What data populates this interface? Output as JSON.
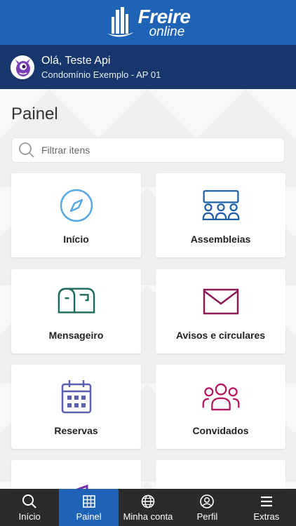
{
  "header": {
    "brand_line1": "Freire",
    "brand_line2": "online"
  },
  "user": {
    "greeting": "Olá, Teste Api",
    "unit": "Condomínio Exemplo - AP 01"
  },
  "page": {
    "title": "Painel"
  },
  "search": {
    "placeholder": "Filtrar itens"
  },
  "cards": [
    {
      "label": "Início",
      "icon": "compass-icon",
      "color": "#5aa8e0"
    },
    {
      "label": "Assembleias",
      "icon": "assembly-icon",
      "color": "#1f5fa8"
    },
    {
      "label": "Mensageiro",
      "icon": "mailbox-icon",
      "color": "#1b6b5b"
    },
    {
      "label": "Avisos e circulares",
      "icon": "envelope-icon",
      "color": "#8a1a57"
    },
    {
      "label": "Reservas",
      "icon": "calendar-icon",
      "color": "#5a5fb0"
    },
    {
      "label": "Convidados",
      "icon": "guests-icon",
      "color": "#b3165f"
    }
  ],
  "tabs": [
    {
      "label": "Início",
      "icon": "search-icon",
      "active": false
    },
    {
      "label": "Painel",
      "icon": "grid-icon",
      "active": true
    },
    {
      "label": "Minha conta",
      "icon": "globe-icon",
      "active": false
    },
    {
      "label": "Perfil",
      "icon": "user-icon",
      "active": false
    },
    {
      "label": "Extras",
      "icon": "menu-icon",
      "active": false
    }
  ],
  "colors": {
    "header": "#1e63b6",
    "userbar": "#17376c",
    "tabbar": "#2b2b2b",
    "tab_active": "#1e63b6"
  }
}
